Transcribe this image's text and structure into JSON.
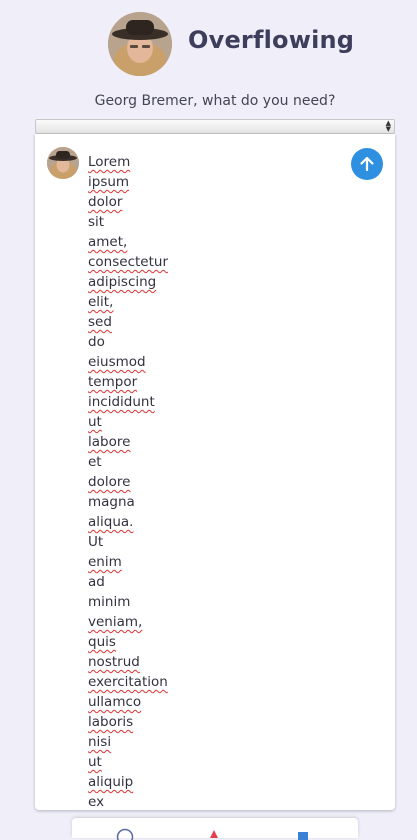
{
  "header": {
    "app_title": "Overflowing",
    "avatar_icon": "user-photo-avatar-icon"
  },
  "prompt": {
    "text": "Georg Bremer, what do you need?"
  },
  "input": {
    "words": [
      {
        "text": "Lorem",
        "misspelled": true
      },
      {
        "text": "ipsum",
        "misspelled": true
      },
      {
        "text": "dolor",
        "misspelled": true
      },
      {
        "text": "sit",
        "misspelled": false
      },
      {
        "text": "amet,",
        "misspelled": true
      },
      {
        "text": "consectetur",
        "misspelled": true
      },
      {
        "text": "adipiscing",
        "misspelled": true
      },
      {
        "text": "elit,",
        "misspelled": true
      },
      {
        "text": "sed",
        "misspelled": true
      },
      {
        "text": "do",
        "misspelled": false
      },
      {
        "text": "eiusmod",
        "misspelled": true
      },
      {
        "text": "tempor",
        "misspelled": true
      },
      {
        "text": "incididunt",
        "misspelled": true
      },
      {
        "text": "ut",
        "misspelled": true
      },
      {
        "text": "labore",
        "misspelled": true
      },
      {
        "text": "et",
        "misspelled": false
      },
      {
        "text": "dolore",
        "misspelled": true
      },
      {
        "text": "magna",
        "misspelled": false
      },
      {
        "text": "aliqua.",
        "misspelled": true
      },
      {
        "text": "Ut",
        "misspelled": false
      },
      {
        "text": "enim",
        "misspelled": true
      },
      {
        "text": "ad",
        "misspelled": false
      },
      {
        "text": "minim",
        "misspelled": false
      },
      {
        "text": "veniam,",
        "misspelled": true
      },
      {
        "text": "quis",
        "misspelled": true
      },
      {
        "text": "nostrud",
        "misspelled": true
      },
      {
        "text": "exercitation",
        "misspelled": true
      },
      {
        "text": "ullamco",
        "misspelled": true
      },
      {
        "text": "laboris",
        "misspelled": true
      },
      {
        "text": "nisi",
        "misspelled": true
      },
      {
        "text": "ut",
        "misspelled": true
      },
      {
        "text": "aliquip",
        "misspelled": true
      },
      {
        "text": "ex",
        "misspelled": false
      }
    ],
    "send_icon": "arrow-up-icon",
    "send_color": "#2f8fe0"
  },
  "colors": {
    "background": "#f0eff9",
    "title": "#3d3d5c",
    "spellcheck": "#dd3333"
  }
}
